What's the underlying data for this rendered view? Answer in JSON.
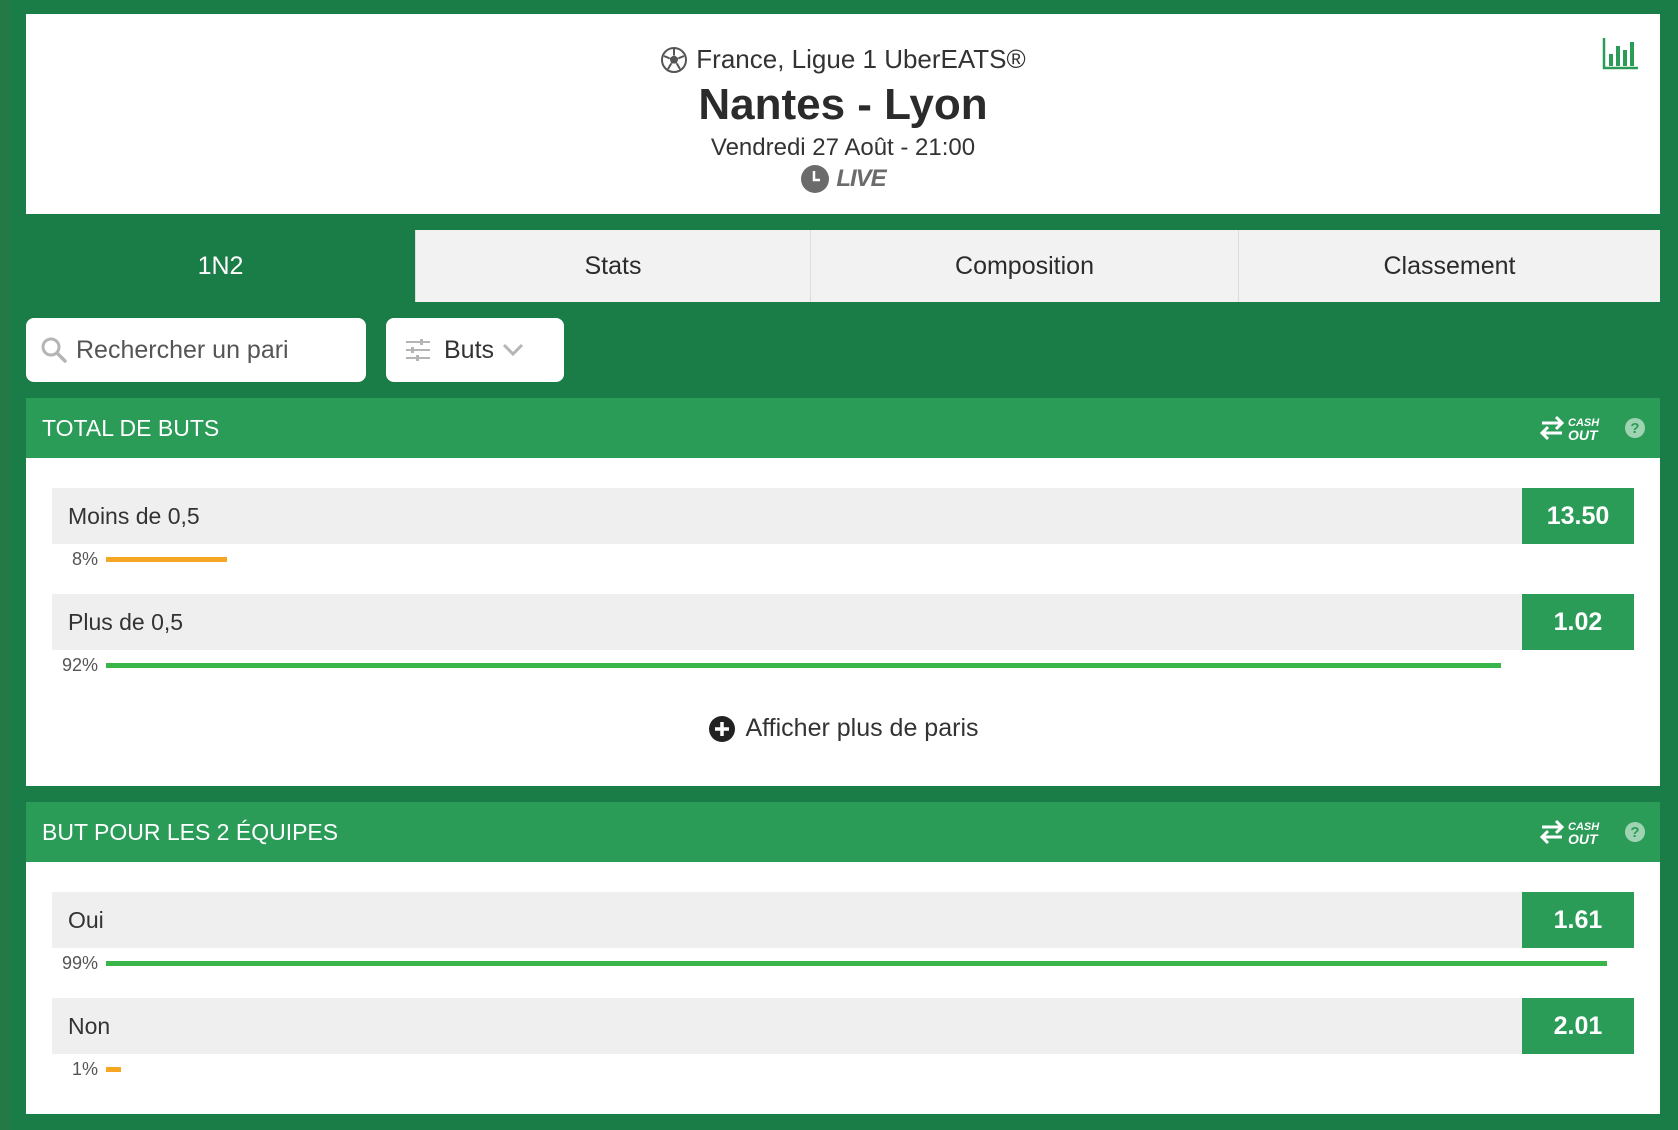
{
  "match": {
    "league": "France, Ligue 1 UberEATS®",
    "title": "Nantes - Lyon",
    "date": "Vendredi 27 Août - 21:00",
    "live": "LIVE"
  },
  "tabs": [
    {
      "label": "1N2",
      "active": true
    },
    {
      "label": "Stats",
      "active": false
    },
    {
      "label": "Composition",
      "active": false
    },
    {
      "label": "Classement",
      "active": false
    }
  ],
  "search": {
    "placeholder": "Rechercher un pari"
  },
  "filter": {
    "label": "Buts"
  },
  "markets": [
    {
      "title": "TOTAL DE BUTS",
      "outcomes": [
        {
          "label": "Moins de 0,5",
          "odds": "13.50",
          "percent_label": "8%",
          "percent": 8
        },
        {
          "label": "Plus de 0,5",
          "odds": "1.02",
          "percent_label": "92%",
          "percent": 92
        }
      ],
      "show_more": "Afficher plus de paris"
    },
    {
      "title": "BUT POUR LES 2 ÉQUIPES",
      "outcomes": [
        {
          "label": "Oui",
          "odds": "1.61",
          "percent_label": "99%",
          "percent": 99
        },
        {
          "label": "Non",
          "odds": "2.01",
          "percent_label": "1%",
          "percent": 1
        }
      ]
    }
  ],
  "colors": {
    "background": "#1a7c46",
    "accent": "#2a9c58",
    "bar_high": "#3ab54a",
    "bar_low": "#f5a623"
  },
  "icons": {
    "league": "soccer-ball-icon",
    "live": "clock-icon",
    "stats": "bar-chart-icon",
    "search": "magnifier-icon",
    "filter": "sliders-icon",
    "cashout": "cashout-icon",
    "help": "question-circle-icon",
    "show_more": "plus-circle-icon"
  }
}
